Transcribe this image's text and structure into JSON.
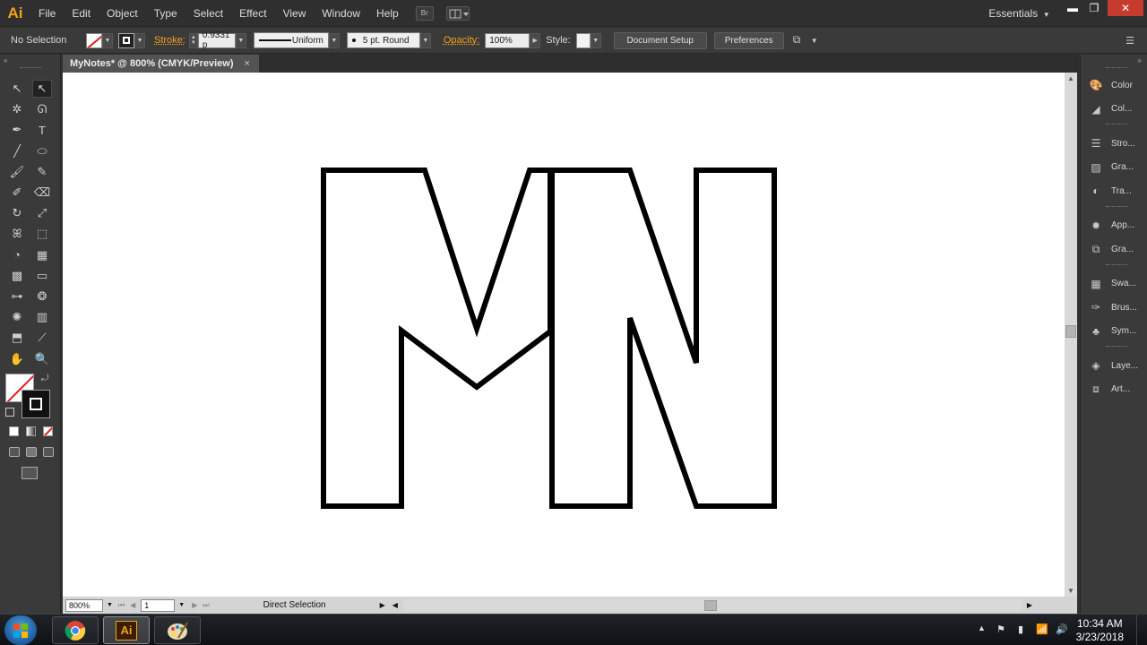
{
  "app": {
    "logo_text": "Ai"
  },
  "menu": {
    "items": [
      "File",
      "Edit",
      "Object",
      "Type",
      "Select",
      "Effect",
      "View",
      "Window",
      "Help"
    ],
    "bridge_label": "Br",
    "workspace": "Essentials",
    "workspace_arrow": "▾"
  },
  "window_controls": {
    "minimize": "▬",
    "restore": "❐",
    "close": "✕"
  },
  "control_bar": {
    "selection_status": "No Selection",
    "stroke_label": "Stroke:",
    "stroke_weight": "0.9331 p",
    "stroke_profile": "Uniform",
    "brush": "5 pt. Round",
    "opacity_label": "Opacity:",
    "opacity_value": "100%",
    "style_label": "Style:",
    "document_setup": "Document Setup",
    "preferences": "Preferences",
    "fill_color": "#ffffff",
    "stroke_none_color": "#e01b1b"
  },
  "document": {
    "tab_title": "MyNotes* @ 800% (CMYK/Preview)",
    "tab_close": "×",
    "artwork_stroke_color": "#000000"
  },
  "status_bar": {
    "zoom": "800%",
    "artboard_number": "1",
    "current_tool": "Direct Selection"
  },
  "tools": [
    {
      "name": "selection-tool-icon",
      "glyph": "↖"
    },
    {
      "name": "direct-selection-tool-icon",
      "glyph": "↖",
      "active": true
    },
    {
      "name": "magic-wand-tool-icon",
      "glyph": "✲"
    },
    {
      "name": "lasso-tool-icon",
      "glyph": "ᘏ"
    },
    {
      "name": "pen-tool-icon",
      "glyph": "✒"
    },
    {
      "name": "type-tool-icon",
      "glyph": "T"
    },
    {
      "name": "line-tool-icon",
      "glyph": "╱"
    },
    {
      "name": "ellipse-tool-icon",
      "glyph": "⬭"
    },
    {
      "name": "paintbrush-tool-icon",
      "glyph": "🖌"
    },
    {
      "name": "pencil-tool-icon",
      "glyph": "✎"
    },
    {
      "name": "blob-brush-tool-icon",
      "glyph": "✐"
    },
    {
      "name": "eraser-tool-icon",
      "glyph": "⌫"
    },
    {
      "name": "rotate-tool-icon",
      "glyph": "↻"
    },
    {
      "name": "scale-tool-icon",
      "glyph": "⤢"
    },
    {
      "name": "warp-tool-icon",
      "glyph": "ꕤ"
    },
    {
      "name": "free-transform-tool-icon",
      "glyph": "⬚"
    },
    {
      "name": "shape-builder-tool-icon",
      "glyph": "◔"
    },
    {
      "name": "perspective-grid-tool-icon",
      "glyph": "▦"
    },
    {
      "name": "mesh-tool-icon",
      "glyph": "▩"
    },
    {
      "name": "gradient-tool-icon",
      "glyph": "▭"
    },
    {
      "name": "eyedropper-tool-icon",
      "glyph": "⊶"
    },
    {
      "name": "blend-tool-icon",
      "glyph": "❂"
    },
    {
      "name": "symbol-sprayer-tool-icon",
      "glyph": "✺"
    },
    {
      "name": "column-graph-tool-icon",
      "glyph": "▥"
    },
    {
      "name": "artboard-tool-icon",
      "glyph": "⬒"
    },
    {
      "name": "slice-tool-icon",
      "glyph": "⟋"
    },
    {
      "name": "hand-tool-icon",
      "glyph": "✋"
    },
    {
      "name": "zoom-tool-icon",
      "glyph": "🔍"
    }
  ],
  "right_dock": [
    {
      "name": "dock-color",
      "label": "Color",
      "icon": "color-icon",
      "glyph": "🎨"
    },
    {
      "name": "dock-color-guide",
      "label": "Col...",
      "icon": "color-guide-icon",
      "glyph": "◢"
    },
    {
      "name": "dock-stroke",
      "label": "Stro...",
      "icon": "stroke-icon",
      "glyph": "☰"
    },
    {
      "name": "dock-gradient",
      "label": "Gra...",
      "icon": "gradient-icon",
      "glyph": "▨"
    },
    {
      "name": "dock-transparency",
      "label": "Tra...",
      "icon": "transparency-icon",
      "glyph": "◐"
    },
    {
      "name": "dock-appearance",
      "label": "App...",
      "icon": "appearance-icon",
      "glyph": "✹"
    },
    {
      "name": "dock-graphic-styles",
      "label": "Gra...",
      "icon": "graphic-styles-icon",
      "glyph": "⧉"
    },
    {
      "name": "dock-swatches",
      "label": "Swa...",
      "icon": "swatches-icon",
      "glyph": "▦"
    },
    {
      "name": "dock-brushes",
      "label": "Brus...",
      "icon": "brushes-icon",
      "glyph": "✑"
    },
    {
      "name": "dock-symbols",
      "label": "Sym...",
      "icon": "symbols-icon",
      "glyph": "♣"
    },
    {
      "name": "dock-layers",
      "label": "Laye...",
      "icon": "layers-icon",
      "glyph": "◈"
    },
    {
      "name": "dock-artboards",
      "label": "Art...",
      "icon": "artboards-icon",
      "glyph": "⧈"
    }
  ],
  "taskbar": {
    "time": "10:34 AM",
    "date": "3/23/2018",
    "illustrator_label": "Ai"
  }
}
